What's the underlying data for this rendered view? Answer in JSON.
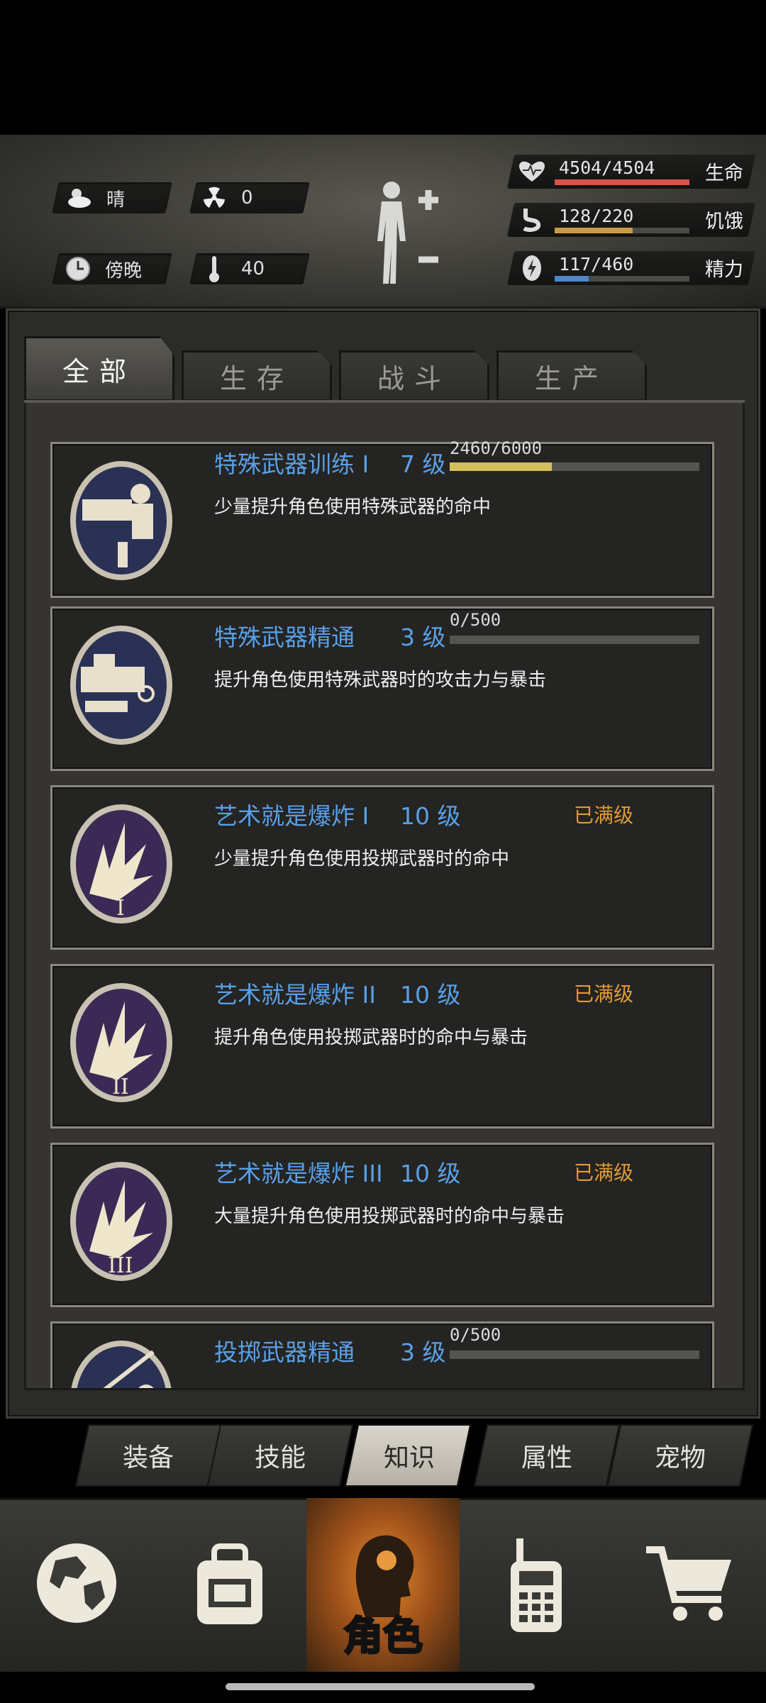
{
  "status": {
    "weather": {
      "icon": "cloud-icon",
      "label": "晴"
    },
    "radiation": {
      "icon": "radiation-icon",
      "value": "0"
    },
    "time": {
      "icon": "clock-icon",
      "label": "傍晚"
    },
    "temperature": {
      "icon": "thermometer-icon",
      "value": "40"
    },
    "health": {
      "value": "4504/4504",
      "label": "生命",
      "fraction": 1.0,
      "color": "#d9524a"
    },
    "hunger": {
      "value": "128/220",
      "label": "饥饿",
      "fraction": 0.58,
      "color": "#c99a48"
    },
    "energy": {
      "value": "117/460",
      "label": "精力",
      "fraction": 0.25,
      "color": "#4f86c6"
    }
  },
  "tabs": [
    {
      "label": "全部",
      "active": true
    },
    {
      "label": "生存",
      "active": false
    },
    {
      "label": "战斗",
      "active": false
    },
    {
      "label": "生产",
      "active": false
    }
  ],
  "skills": [
    {
      "name": "特殊武器训练 I",
      "level": "7 级",
      "xp": "2460/6000",
      "xp_fraction": 0.41,
      "maxed": "",
      "desc": "少量提升角色使用特殊武器的命中",
      "emblem": "gatling-gunner-icon"
    },
    {
      "name": "特殊武器精通",
      "level": "3 级",
      "xp": "0/500",
      "xp_fraction": 0,
      "maxed": "",
      "desc": "提升角色使用特殊武器时的攻击力与暴击",
      "emblem": "gatling-gun-icon"
    },
    {
      "name": "艺术就是爆炸 I",
      "level": "10 级",
      "xp": "",
      "xp_fraction": null,
      "maxed": "已满级",
      "desc": "少量提升角色使用投掷武器时的命中",
      "emblem": "explosion-icon"
    },
    {
      "name": "艺术就是爆炸 II",
      "level": "10 级",
      "xp": "",
      "xp_fraction": null,
      "maxed": "已满级",
      "desc": "提升角色使用投掷武器时的命中与暴击",
      "emblem": "explosion-icon"
    },
    {
      "name": "艺术就是爆炸 III",
      "level": "10 级",
      "xp": "",
      "xp_fraction": null,
      "maxed": "已满级",
      "desc": "大量提升角色使用投掷武器时的命中与暴击",
      "emblem": "explosion-icon"
    },
    {
      "name": "投掷武器精通",
      "level": "3 级",
      "xp": "0/500",
      "xp_fraction": 0,
      "maxed": "",
      "desc": "",
      "emblem": "throw-icon"
    }
  ],
  "subtabs": [
    {
      "label": "装备",
      "active": false
    },
    {
      "label": "技能",
      "active": false
    },
    {
      "label": "知识",
      "active": true
    },
    {
      "label": "属性",
      "active": false
    },
    {
      "label": "宠物",
      "active": false
    }
  ],
  "nav": [
    {
      "icon": "globe-icon",
      "label": ""
    },
    {
      "icon": "backpack-icon",
      "label": ""
    },
    {
      "icon": "character-head-icon",
      "label": "角色",
      "active": true
    },
    {
      "icon": "walkie-talkie-icon",
      "label": ""
    },
    {
      "icon": "cart-icon",
      "label": ""
    }
  ]
}
